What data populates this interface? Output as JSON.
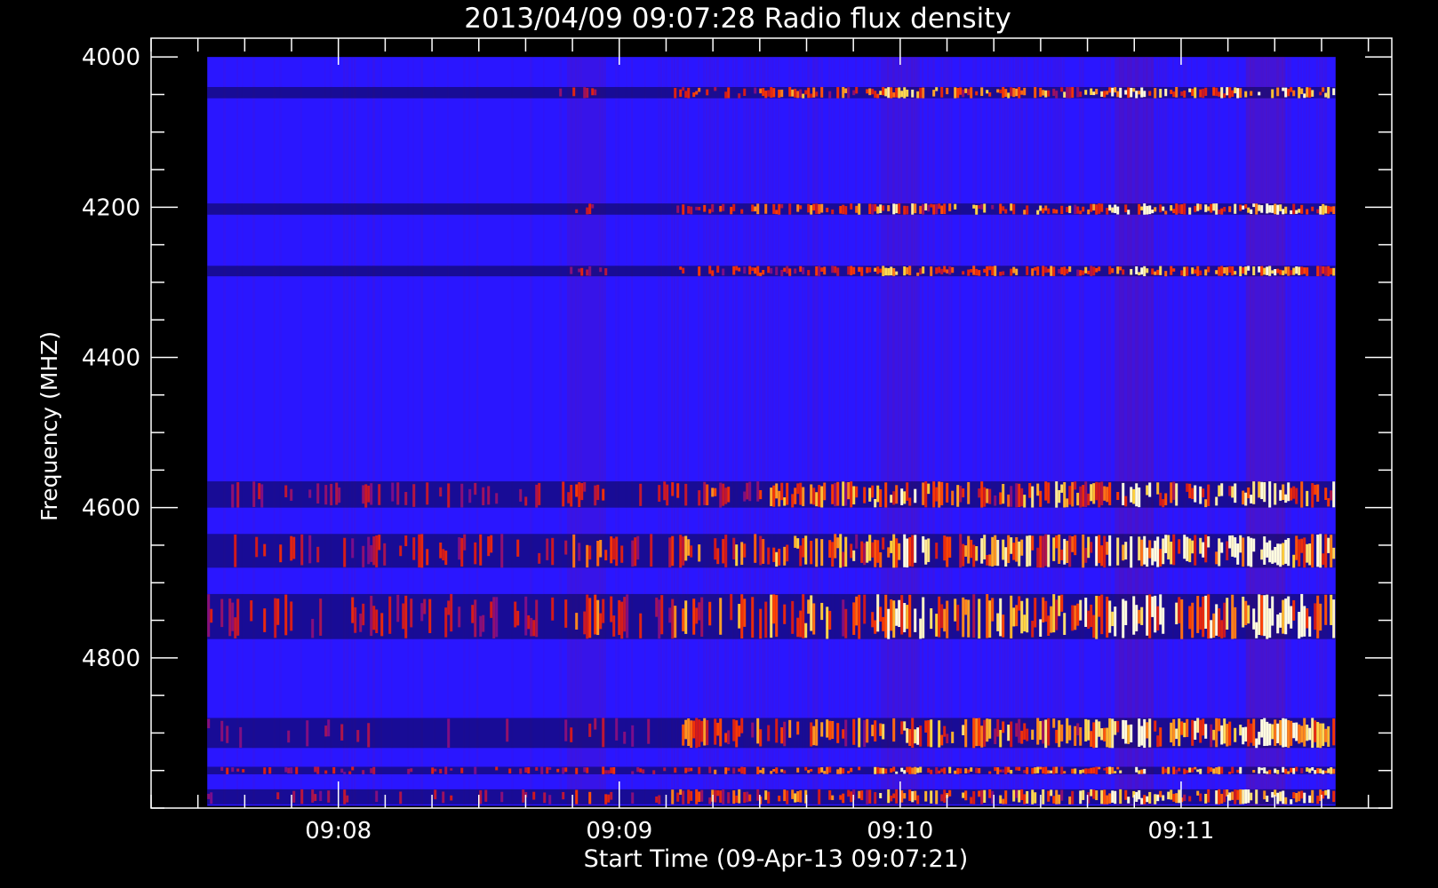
{
  "chart_data": {
    "type": "heatmap",
    "title": "2013/04/09 09:07:28 Radio flux density",
    "xlabel": "Start Time (09-Apr-13 09:07:21)",
    "ylabel": "Frequency (MHZ)",
    "x_axis": {
      "unit": "time",
      "range": [
        "09:07:20",
        "09:11:45"
      ],
      "data_range": [
        "09:07:32",
        "09:11:33"
      ],
      "major_ticks": [
        "09:08",
        "09:09",
        "09:10",
        "09:11"
      ],
      "minor_ticks_per_major": 6
    },
    "y_axis": {
      "unit": "MHz",
      "inverted": true,
      "range": [
        3975,
        5000
      ],
      "data_range": [
        4000,
        4997
      ],
      "major_ticks": [
        4000,
        4200,
        4400,
        4600,
        4800
      ],
      "minor_step": 50
    },
    "colormap": [
      "#000000",
      "#1f00ff",
      "#d41a1a",
      "#ff3b00",
      "#ffd23a",
      "#fffce0"
    ],
    "background_color": "#2a16ff",
    "grid": false,
    "legend": "none",
    "regime_change_time": "09:09:11",
    "emission_bands": [
      {
        "freq_min": 4040,
        "freq_max": 4055,
        "intensity_early": 0.45,
        "intensity_late": 0.9
      },
      {
        "freq_min": 4195,
        "freq_max": 4210,
        "intensity_early": 0.25,
        "intensity_late": 0.85
      },
      {
        "freq_min": 4278,
        "freq_max": 4292,
        "intensity_early": 0.35,
        "intensity_late": 0.75
      },
      {
        "freq_min": 4565,
        "freq_max": 4600,
        "intensity_early": 0.6,
        "intensity_late": 0.9
      },
      {
        "freq_min": 4635,
        "freq_max": 4680,
        "intensity_early": 0.75,
        "intensity_late": 1.0
      },
      {
        "freq_min": 4715,
        "freq_max": 4775,
        "intensity_early": 0.75,
        "intensity_late": 1.0
      },
      {
        "freq_min": 4880,
        "freq_max": 4920,
        "intensity_early": 0.55,
        "intensity_late": 0.9
      },
      {
        "freq_min": 4945,
        "freq_max": 4955,
        "intensity_early": 0.7,
        "intensity_late": 0.85
      },
      {
        "freq_min": 4975,
        "freq_max": 4995,
        "intensity_early": 0.6,
        "intensity_late": 0.9
      }
    ],
    "burst_columns": [
      {
        "time": "09:11:18",
        "intensity": 1.0
      },
      {
        "time": "09:10:50",
        "intensity": 0.85
      },
      {
        "time": "09:10:00",
        "intensity": 0.6
      },
      {
        "time": "09:08:53",
        "intensity": 0.55
      }
    ]
  }
}
